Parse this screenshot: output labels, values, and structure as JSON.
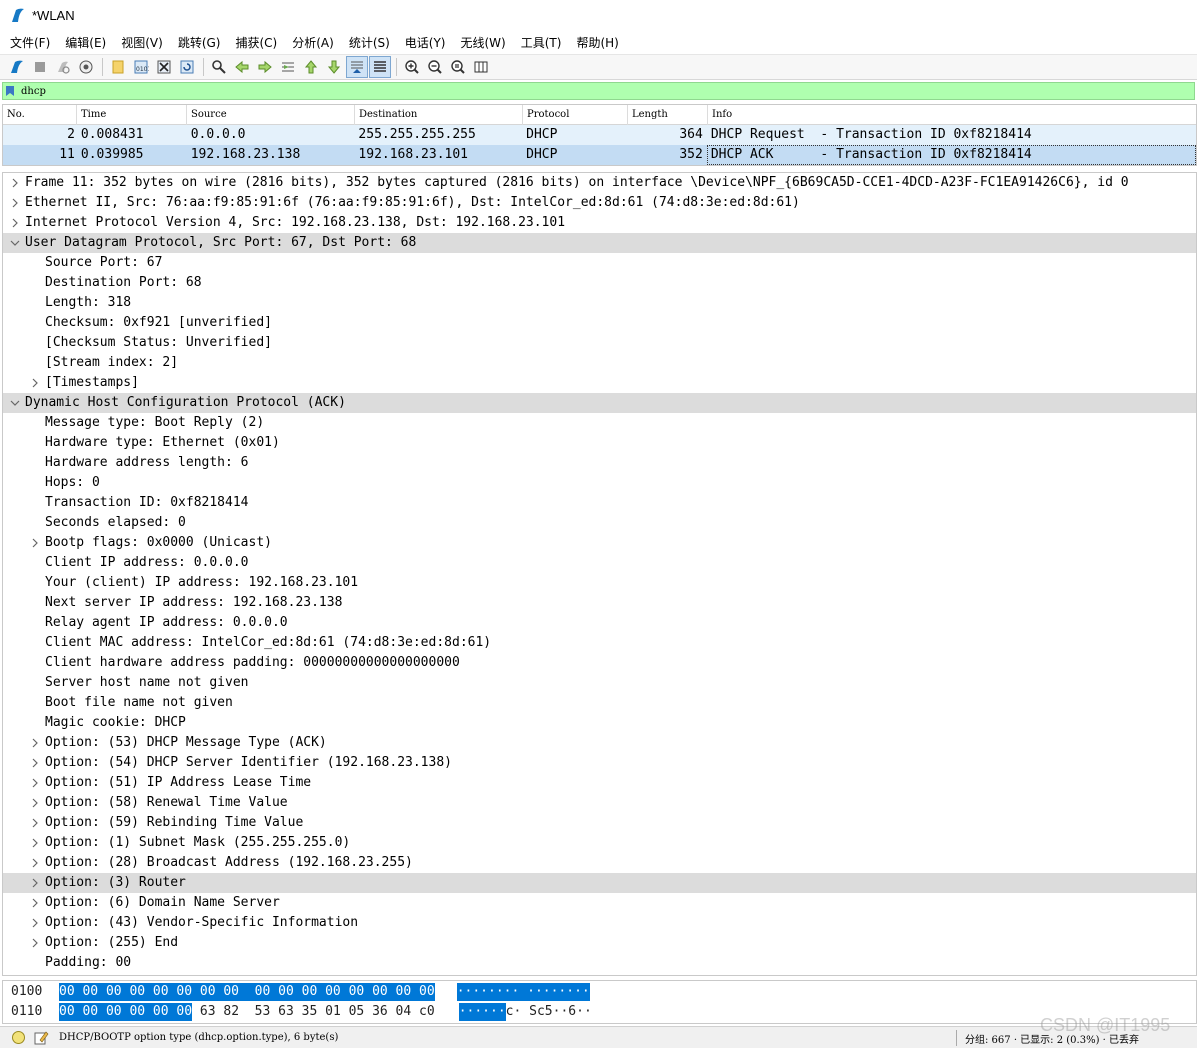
{
  "window": {
    "title": "*WLAN"
  },
  "menu": [
    "文件(F)",
    "编辑(E)",
    "视图(V)",
    "跳转(G)",
    "捕获(C)",
    "分析(A)",
    "统计(S)",
    "电话(Y)",
    "无线(W)",
    "工具(T)",
    "帮助(H)"
  ],
  "toolbar": {
    "icons": [
      "shark-fin-start-icon",
      "stop-capture-icon",
      "restart-capture-icon",
      "capture-options-icon",
      "open-file-icon",
      "save-file-icon",
      "close-file-icon",
      "reload-file-icon",
      "find-packet-icon",
      "go-back-icon",
      "go-forward-icon",
      "go-to-packet-icon",
      "first-packet-icon",
      "last-packet-icon",
      "autoscroll-icon",
      "colorize-icon",
      "zoom-in-icon",
      "zoom-out-icon",
      "zoom-normal-icon",
      "resize-columns-icon"
    ]
  },
  "filter": {
    "value": "dhcp"
  },
  "packet_list": {
    "columns": [
      "No.",
      "Time",
      "Source",
      "Destination",
      "Protocol",
      "Length",
      "Info"
    ],
    "rows": [
      {
        "no": "2",
        "time": "0.008431",
        "src": "0.0.0.0",
        "dst": "255.255.255.255",
        "proto": "DHCP",
        "len": "364",
        "info": "DHCP Request  - Transaction ID 0xf8218414"
      },
      {
        "no": "11",
        "time": "0.039985",
        "src": "192.168.23.138",
        "dst": "192.168.23.101",
        "proto": "DHCP",
        "len": "352",
        "info": "DHCP ACK      - Transaction ID 0xf8218414"
      }
    ]
  },
  "details": [
    {
      "level": 0,
      "arrow": "collapsed",
      "text": "Frame 11: 352 bytes on wire (2816 bits), 352 bytes captured (2816 bits) on interface \\Device\\NPF_{6B69CA5D-CCE1-4DCD-A23F-FC1EA91426C6}, id 0"
    },
    {
      "level": 0,
      "arrow": "collapsed",
      "text": "Ethernet II, Src: 76:aa:f9:85:91:6f (76:aa:f9:85:91:6f), Dst: IntelCor_ed:8d:61 (74:d8:3e:ed:8d:61)"
    },
    {
      "level": 0,
      "arrow": "collapsed",
      "text": "Internet Protocol Version 4, Src: 192.168.23.138, Dst: 192.168.23.101"
    },
    {
      "level": 0,
      "arrow": "expanded",
      "text": "User Datagram Protocol, Src Port: 67, Dst Port: 68",
      "hl": true
    },
    {
      "level": 1,
      "arrow": "none",
      "text": "Source Port: 67"
    },
    {
      "level": 1,
      "arrow": "none",
      "text": "Destination Port: 68"
    },
    {
      "level": 1,
      "arrow": "none",
      "text": "Length: 318"
    },
    {
      "level": 1,
      "arrow": "none",
      "text": "Checksum: 0xf921 [unverified]"
    },
    {
      "level": 1,
      "arrow": "none",
      "text": "[Checksum Status: Unverified]"
    },
    {
      "level": 1,
      "arrow": "none",
      "text": "[Stream index: 2]"
    },
    {
      "level": 1,
      "arrow": "collapsed",
      "text": "[Timestamps]"
    },
    {
      "level": 0,
      "arrow": "expanded",
      "text": "Dynamic Host Configuration Protocol (ACK)",
      "hl": true
    },
    {
      "level": 1,
      "arrow": "none",
      "text": "Message type: Boot Reply (2)"
    },
    {
      "level": 1,
      "arrow": "none",
      "text": "Hardware type: Ethernet (0x01)"
    },
    {
      "level": 1,
      "arrow": "none",
      "text": "Hardware address length: 6"
    },
    {
      "level": 1,
      "arrow": "none",
      "text": "Hops: 0"
    },
    {
      "level": 1,
      "arrow": "none",
      "text": "Transaction ID: 0xf8218414"
    },
    {
      "level": 1,
      "arrow": "none",
      "text": "Seconds elapsed: 0"
    },
    {
      "level": 1,
      "arrow": "collapsed",
      "text": "Bootp flags: 0x0000 (Unicast)"
    },
    {
      "level": 1,
      "arrow": "none",
      "text": "Client IP address: 0.0.0.0"
    },
    {
      "level": 1,
      "arrow": "none",
      "text": "Your (client) IP address: 192.168.23.101"
    },
    {
      "level": 1,
      "arrow": "none",
      "text": "Next server IP address: 192.168.23.138"
    },
    {
      "level": 1,
      "arrow": "none",
      "text": "Relay agent IP address: 0.0.0.0"
    },
    {
      "level": 1,
      "arrow": "none",
      "text": "Client MAC address: IntelCor_ed:8d:61 (74:d8:3e:ed:8d:61)"
    },
    {
      "level": 1,
      "arrow": "none",
      "text": "Client hardware address padding: 00000000000000000000"
    },
    {
      "level": 1,
      "arrow": "none",
      "text": "Server host name not given"
    },
    {
      "level": 1,
      "arrow": "none",
      "text": "Boot file name not given"
    },
    {
      "level": 1,
      "arrow": "none",
      "text": "Magic cookie: DHCP"
    },
    {
      "level": 1,
      "arrow": "collapsed",
      "text": "Option: (53) DHCP Message Type (ACK)"
    },
    {
      "level": 1,
      "arrow": "collapsed",
      "text": "Option: (54) DHCP Server Identifier (192.168.23.138)"
    },
    {
      "level": 1,
      "arrow": "collapsed",
      "text": "Option: (51) IP Address Lease Time"
    },
    {
      "level": 1,
      "arrow": "collapsed",
      "text": "Option: (58) Renewal Time Value"
    },
    {
      "level": 1,
      "arrow": "collapsed",
      "text": "Option: (59) Rebinding Time Value"
    },
    {
      "level": 1,
      "arrow": "collapsed",
      "text": "Option: (1) Subnet Mask (255.255.255.0)"
    },
    {
      "level": 1,
      "arrow": "collapsed",
      "text": "Option: (28) Broadcast Address (192.168.23.255)"
    },
    {
      "level": 1,
      "arrow": "collapsed",
      "text": "Option: (3) Router",
      "hl": true
    },
    {
      "level": 1,
      "arrow": "collapsed",
      "text": "Option: (6) Domain Name Server"
    },
    {
      "level": 1,
      "arrow": "collapsed",
      "text": "Option: (43) Vendor-Specific Information"
    },
    {
      "level": 1,
      "arrow": "collapsed",
      "text": "Option: (255) End"
    },
    {
      "level": 1,
      "arrow": "none",
      "text": "Padding: 00"
    }
  ],
  "bytes": [
    {
      "offset": "0100",
      "hex_sel": "00 00 00 00 00 00 00 00  00 00 00 00 00 00 00 00",
      "hex_rest": "",
      "ascii_sel": "········ ········",
      "ascii_rest": ""
    },
    {
      "offset": "0110",
      "hex_sel": "00 00 00 00 00 00",
      "hex_rest": " 63 82  53 63 35 01 05 36 04 c0",
      "ascii_sel": "······",
      "ascii_rest": "c· Sc5··6··"
    }
  ],
  "status": {
    "field": "DHCP/BOOTP option type (dhcp.option.type), 6 byte(s)",
    "packets": "分组: 667 · 已显示: 2 (0.3%) · 已丢弃",
    "watermark": "CSDN @IT1995"
  },
  "colors": {
    "filter_bg": "#afffaf",
    "selected_row": "#c3dcf3",
    "byte_selection": "#0078d7"
  }
}
